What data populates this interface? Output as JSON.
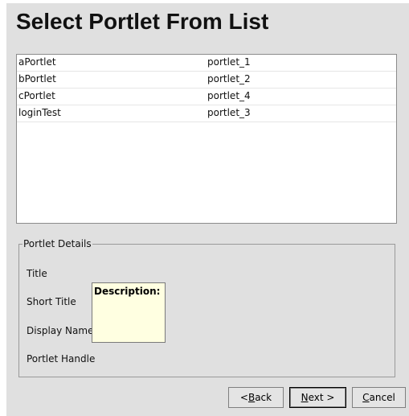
{
  "header": {
    "title": "Select Portlet From List"
  },
  "portlet_list": {
    "rows": [
      {
        "name": "aPortlet",
        "handle": "portlet_1"
      },
      {
        "name": "bPortlet",
        "handle": "portlet_2"
      },
      {
        "name": "cPortlet",
        "handle": "portlet_4"
      },
      {
        "name": "loginTest",
        "handle": "portlet_3"
      }
    ]
  },
  "details": {
    "legend": "Portlet Details",
    "fields": {
      "title": "Title",
      "short_title": "Short Title",
      "display_name": "Display Name",
      "portlet_handle": "Portlet Handle"
    },
    "tooltip": "Description:"
  },
  "buttons": {
    "back": {
      "prefix": "< ",
      "mnemonic": "B",
      "rest": "ack"
    },
    "next": {
      "prefix": "",
      "mnemonic": "N",
      "rest": "ext >"
    },
    "cancel": {
      "prefix": "",
      "mnemonic": "C",
      "rest": "ancel"
    }
  },
  "colors": {
    "dialog_background": "#e0e0e0",
    "list_background": "#ffffff",
    "tooltip_background": "#ffffe1"
  }
}
